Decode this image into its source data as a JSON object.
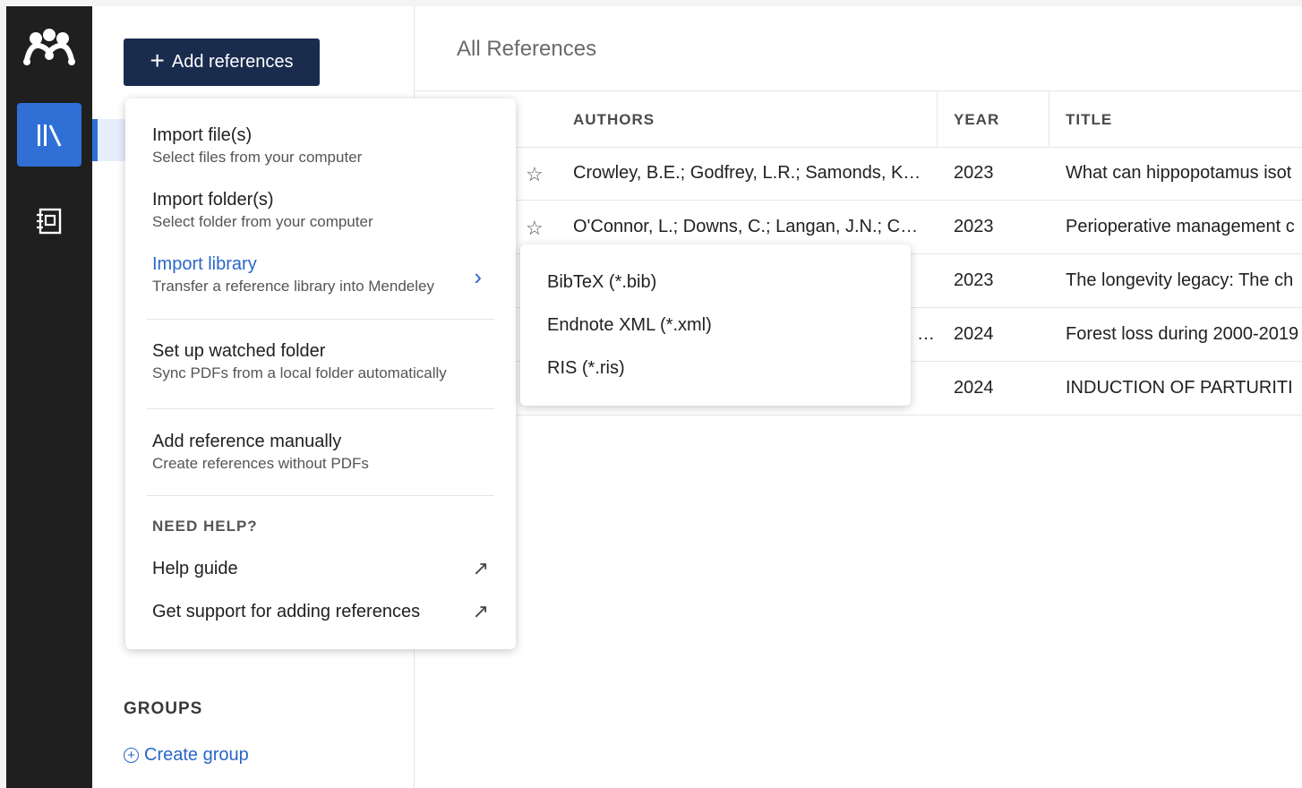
{
  "rail": {
    "logo_icon": "mendeley-logo-icon",
    "items": [
      {
        "name": "library-icon",
        "active": true
      },
      {
        "name": "notebook-icon",
        "active": false
      }
    ]
  },
  "side": {
    "add_label": "Add references",
    "groups_heading": "GROUPS",
    "create_group_label": "Create group"
  },
  "main": {
    "title": "All References",
    "columns": [
      "AUTHORS",
      "YEAR",
      "TITLE"
    ],
    "rows": [
      {
        "authors": "Crowley, B.E.; Godfrey, L.R.; Samonds, K…",
        "year": "2023",
        "title": "What can hippopotamus isot"
      },
      {
        "authors": "O'Connor, L.; Downs, C.; Langan, J.N.; C…",
        "year": "2023",
        "title": "Perioperative management c"
      },
      {
        "authors": "",
        "year": "2023",
        "title": "The longevity legacy: The ch"
      },
      {
        "authors": "…",
        "year": "2024",
        "title": "Forest loss during 2000-2019"
      },
      {
        "authors": "",
        "year": "2024",
        "title": "INDUCTION OF PARTURITI"
      }
    ]
  },
  "menu": {
    "items": [
      {
        "title": "Import file(s)",
        "subtitle": "Select files from your computer"
      },
      {
        "title": "Import folder(s)",
        "subtitle": "Select folder from your computer"
      },
      {
        "title": "Import library",
        "subtitle": "Transfer a reference library into Mendeley"
      },
      {
        "title": "Set up watched folder",
        "subtitle": "Sync PDFs from a local folder automatically"
      },
      {
        "title": "Add reference manually",
        "subtitle": "Create references without PDFs"
      }
    ],
    "help_heading": "NEED HELP?",
    "help_links": [
      "Help guide",
      "Get support for adding references"
    ]
  },
  "submenu": {
    "items": [
      "BibTeX (*.bib)",
      "Endnote XML (*.xml)",
      "RIS (*.ris)"
    ]
  },
  "colors": {
    "rail_bg": "#1f1f1f",
    "accent_blue": "#2f6fd6",
    "add_button_bg": "#1a2c4e",
    "link_blue": "#2a66c9"
  }
}
